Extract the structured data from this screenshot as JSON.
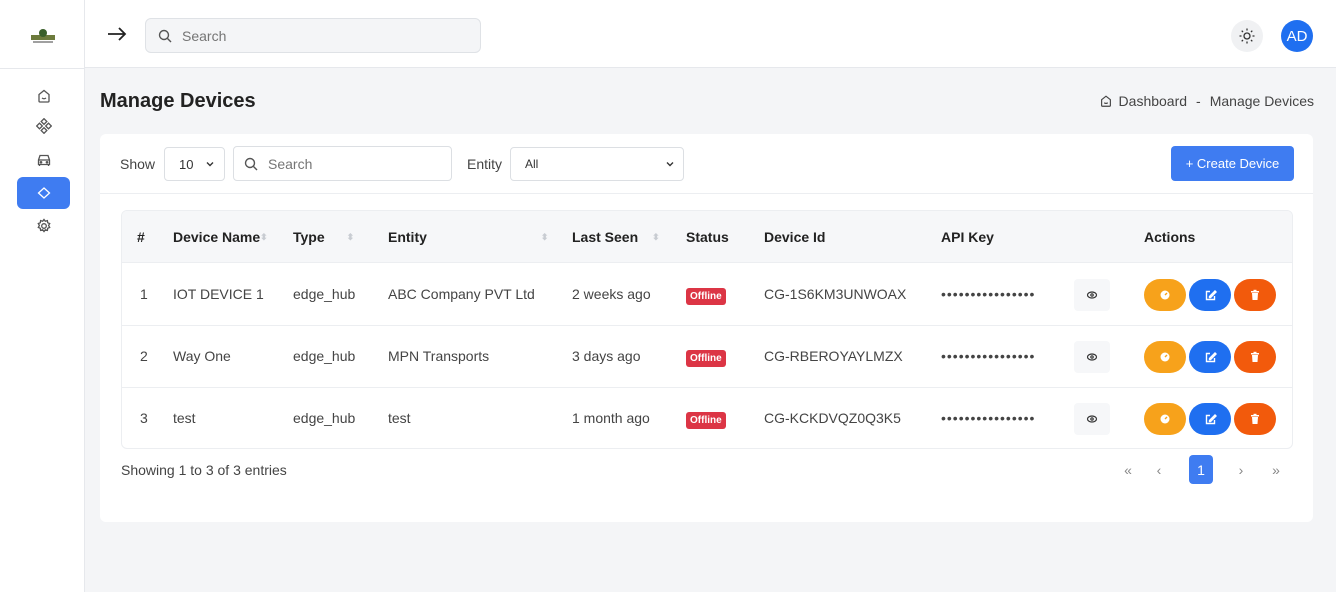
{
  "header": {
    "search_placeholder": "Search",
    "avatar_initials": "AD"
  },
  "sidebar": {
    "items": [
      {
        "icon": "home-icon"
      },
      {
        "icon": "network-icon"
      },
      {
        "icon": "car-icon"
      },
      {
        "icon": "devices-icon",
        "active": true
      },
      {
        "icon": "gear-icon"
      }
    ]
  },
  "page": {
    "title": "Manage Devices"
  },
  "breadcrumb": {
    "home": "Dashboard",
    "sep": "-",
    "current": "Manage Devices"
  },
  "toolbar": {
    "show_label": "Show",
    "show_value": "10",
    "search_placeholder": "Search",
    "entity_label": "Entity",
    "entity_value": "All",
    "create_label": "+ Create Device"
  },
  "table": {
    "headers": {
      "num": "#",
      "name": "Device Name",
      "type": "Type",
      "entity": "Entity",
      "last_seen": "Last Seen",
      "status": "Status",
      "device_id": "Device Id",
      "api_key": "API Key",
      "actions": "Actions"
    },
    "rows": [
      {
        "num": "1",
        "name": "IOT DEVICE 1",
        "type": "edge_hub",
        "entity": "ABC Company PVT Ltd",
        "last_seen": "2 weeks ago",
        "status": "Offline",
        "device_id": "CG-1S6KM3UNWOAX",
        "api_key": "••••••••••••••••"
      },
      {
        "num": "2",
        "name": "Way One",
        "type": "edge_hub",
        "entity": "MPN Transports",
        "last_seen": "3 days ago",
        "status": "Offline",
        "device_id": "CG-RBEROYAYLMZX",
        "api_key": "••••••••••••••••"
      },
      {
        "num": "3",
        "name": "test",
        "type": "edge_hub",
        "entity": "test",
        "last_seen": "1 month ago",
        "status": "Offline",
        "device_id": "CG-KCKDVQZ0Q3K5",
        "api_key": "••••••••••••••••"
      }
    ]
  },
  "footer": {
    "entries_text": "Showing 1 to 3 of 3 entries"
  },
  "pagination": {
    "first": "«",
    "prev": "‹",
    "current": "1",
    "next": "›",
    "last": "»"
  },
  "colors": {
    "primary": "#3f7cf1",
    "offline": "#dc3545",
    "view": "#f7a21b",
    "edit": "#1f6ff0",
    "delete": "#f25a0c"
  }
}
